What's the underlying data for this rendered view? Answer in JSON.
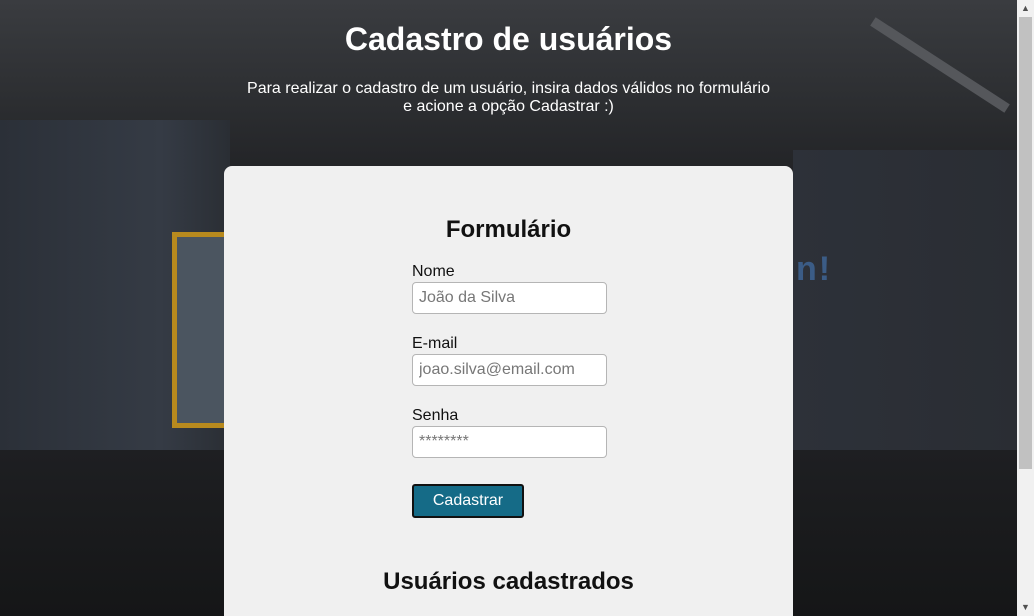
{
  "header": {
    "title": "Cadastro de usuários",
    "subtitle_line1": "Para realizar o cadastro de um usuário, insira dados válidos no formulário",
    "subtitle_line2": "e acione a opção Cadastrar :)"
  },
  "form": {
    "title": "Formulário",
    "name_label": "Nome",
    "name_placeholder": "João da Silva",
    "email_label": "E-mail",
    "email_placeholder": "joao.silva@email.com",
    "password_label": "Senha",
    "password_placeholder": "********",
    "submit_label": "Cadastrar"
  },
  "users": {
    "title": "Usuários cadastrados"
  },
  "colors": {
    "button": "#156b87",
    "card": "#f0f0f0"
  },
  "icons": {
    "scroll_up": "triangle-up-icon",
    "scroll_down": "triangle-down-icon"
  }
}
